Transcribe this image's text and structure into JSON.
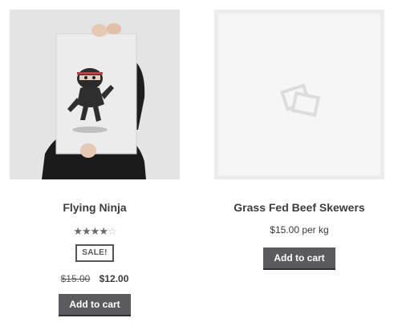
{
  "products": [
    {
      "title": "Flying Ninja",
      "rating": 4,
      "rating_max": 5,
      "sale_badge": "SALE!",
      "price_old": "$15.00",
      "price_new": "$12.00",
      "button_label": "Add to cart",
      "image_icon": "ninja-poster-photo"
    },
    {
      "title": "Grass Fed Beef Skewers",
      "price": "$15.00 per kg",
      "button_label": "Add to cart",
      "image_icon": "placeholder-image-icon"
    }
  ],
  "colors": {
    "button_bg": "#5b5b5f",
    "button_text": "#ffffff",
    "text": "#3a3a3a",
    "thumb_bg": "#e3e3e3",
    "placeholder_bg": "#f6f6f6"
  }
}
